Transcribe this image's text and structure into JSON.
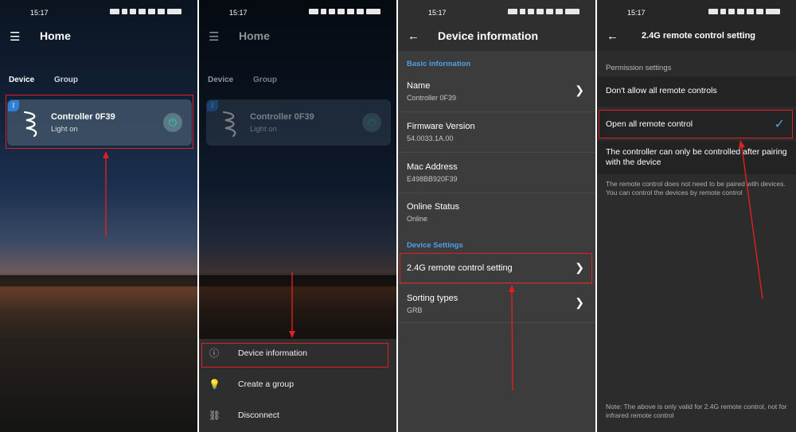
{
  "status": {
    "time": "15:17"
  },
  "screen1": {
    "title": "Home",
    "tabs": [
      "Device",
      "Group"
    ],
    "device": {
      "name": "Controller 0F39",
      "status": "Light on"
    }
  },
  "screen2": {
    "title": "Home",
    "tabs": [
      "Device",
      "Group"
    ],
    "device": {
      "name": "Controller 0F39",
      "status": "Light on"
    },
    "menu": [
      {
        "icon": "info-icon",
        "label": "Device information"
      },
      {
        "icon": "lightbulb-icon",
        "label": "Create a group"
      },
      {
        "icon": "unlink-icon",
        "label": "Disconnect"
      }
    ]
  },
  "screen3": {
    "title": "Device information",
    "basic_header": "Basic information",
    "rows": [
      {
        "title": "Name",
        "value": "Controller 0F39"
      },
      {
        "title": "Firmware Version",
        "value": "54.0033.1A.00"
      },
      {
        "title": "Mac Address",
        "value": "E498BB920F39"
      },
      {
        "title": "Online Status",
        "value": "Online"
      }
    ],
    "settings_header": "Device Settings",
    "setting_rows": [
      {
        "title": "2.4G remote control setting",
        "value": ""
      },
      {
        "title": "Sorting types",
        "value": "GRB"
      }
    ]
  },
  "screen4": {
    "title": "2.4G remote control setting",
    "permission_label": "Permission settings",
    "options": [
      "Don't allow all remote controls",
      "Open all remote control",
      "The controller can only be controlled after pairing with the device"
    ],
    "selected_index": 1,
    "description": "The remote control does not need to be paired with devices. You can control the devices by remote control",
    "note": "Note: The above is only valid for 2.4G remote control, not for infrared remote control"
  },
  "colors": {
    "accent": "#4ea0e6",
    "highlight": "#e02020",
    "power": "#2fd0c0"
  }
}
